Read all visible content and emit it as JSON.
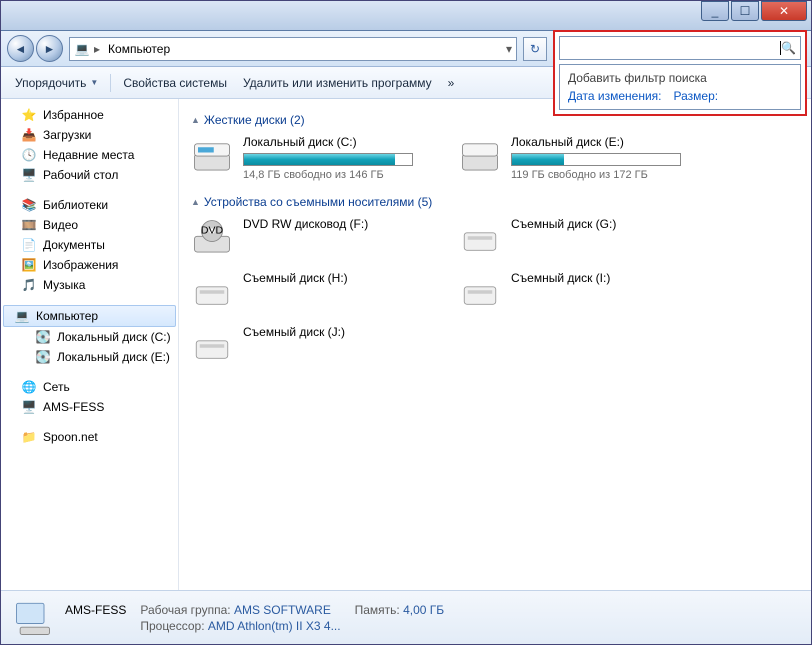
{
  "titlebar": {
    "min": "_",
    "max": "☐",
    "close": "✕"
  },
  "nav": {
    "back": "◄",
    "fwd": "►"
  },
  "address": {
    "icon": "💻",
    "crumb1": "Компьютер",
    "arrow": "▸",
    "dd": "▾",
    "refresh": "↻"
  },
  "search": {
    "placeholder": "",
    "icon": "🔍",
    "addFilter": "Добавить фильтр поиска",
    "dateMod": "Дата изменения:",
    "size": "Размер:"
  },
  "toolbar": {
    "organize": "Упорядочить",
    "sysprop": "Свойства системы",
    "uninstall": "Удалить или изменить программу",
    "more": "»",
    "views": "▥",
    "help": "?"
  },
  "sidebar": {
    "fav": {
      "hdr": "Избранное",
      "downloads": "Загрузки",
      "recent": "Недавние места",
      "desktop": "Рабочий стол"
    },
    "lib": {
      "hdr": "Библиотеки",
      "video": "Видео",
      "docs": "Документы",
      "pics": "Изображения",
      "music": "Музыка"
    },
    "comp": {
      "hdr": "Компьютер",
      "c": "Локальный диск (C:)",
      "e": "Локальный диск (E:)"
    },
    "net": {
      "hdr": "Сеть",
      "host": "AMS-FESS"
    },
    "spoon": "Spoon.net"
  },
  "content": {
    "hdd": {
      "title": "Жесткие диски (2)",
      "c": {
        "name": "Локальный диск (C:)",
        "free": "14,8 ГБ свободно из 146 ГБ",
        "pct": 90
      },
      "e": {
        "name": "Локальный диск (E:)",
        "free": "119 ГБ свободно из 172 ГБ",
        "pct": 31
      }
    },
    "rem": {
      "title": "Устройства со съемными носителями (5)",
      "dvd": "DVD RW дисковод (F:)",
      "g": "Съемный диск (G:)",
      "h": "Съемный диск (H:)",
      "i": "Съемный диск (I:)",
      "j": "Съемный диск (J:)"
    }
  },
  "status": {
    "name": "AMS-FESS",
    "wglabel": "Рабочая группа:",
    "wg": "AMS SOFTWARE",
    "memlabel": "Память:",
    "mem": "4,00 ГБ",
    "cpulabel": "Процессор:",
    "cpu": "AMD Athlon(tm) II X3 4..."
  }
}
